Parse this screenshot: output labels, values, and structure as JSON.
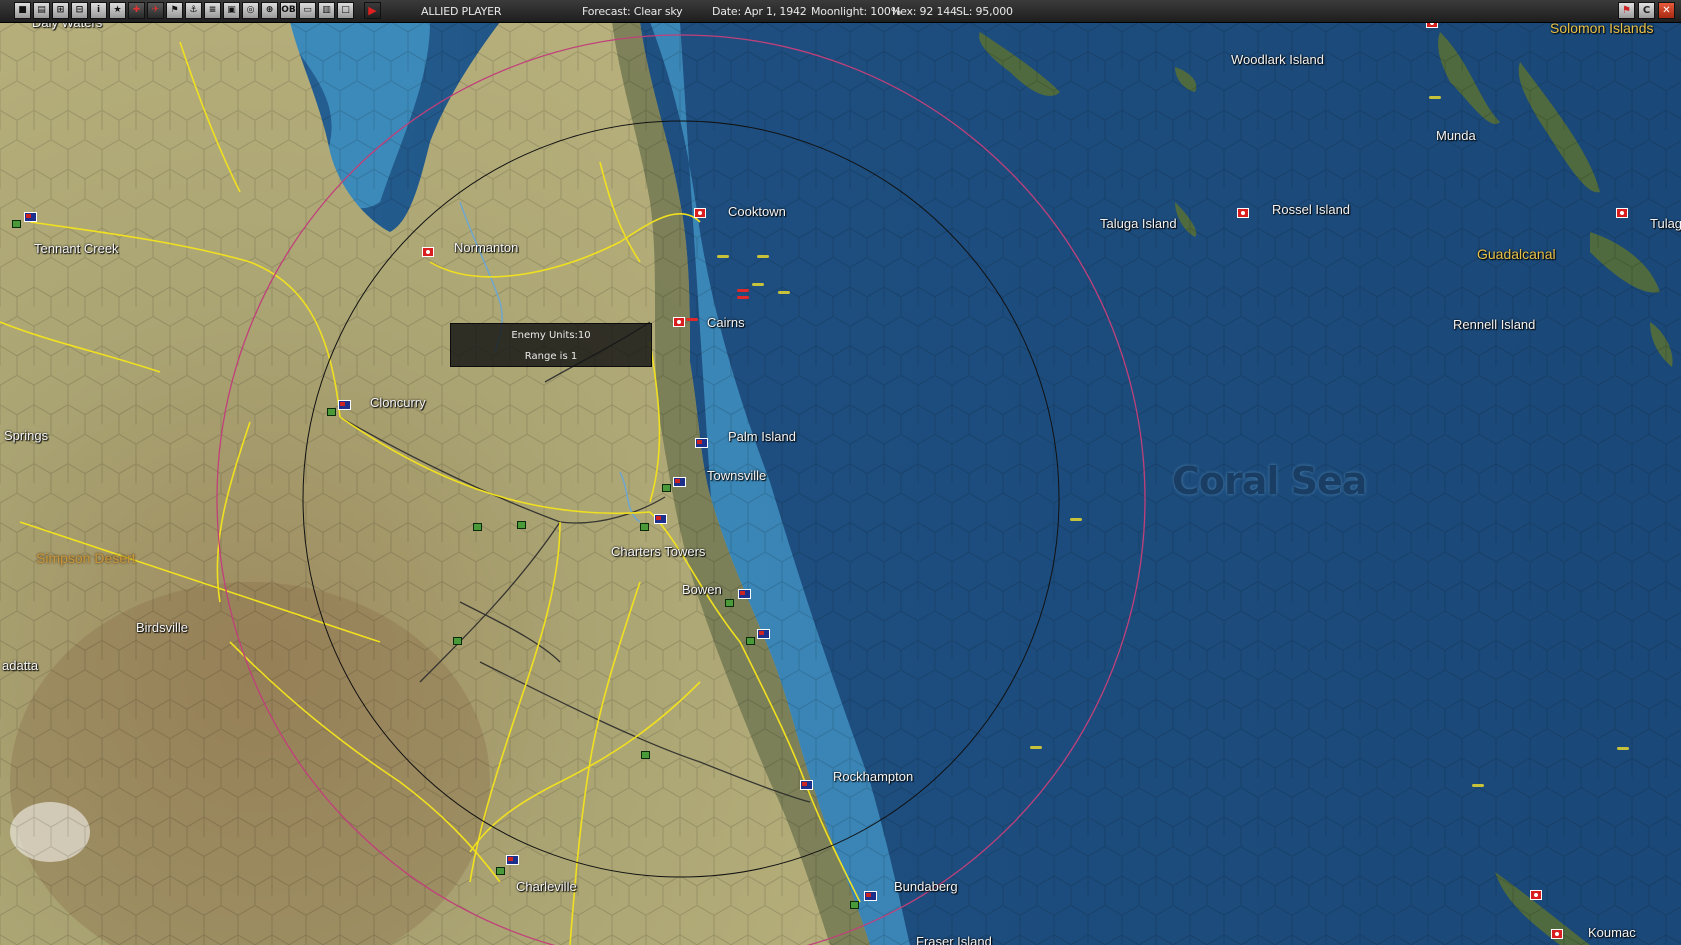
{
  "toolbar": {
    "buttons": [
      "■",
      "▤",
      "⊞",
      "⊟",
      "i",
      "★",
      "✚",
      "✈",
      "⚑",
      "⚓",
      "≡",
      "▣",
      "◎",
      "⊕",
      "OB",
      "▭",
      "▥",
      "□"
    ],
    "play_icon": "play-icon"
  },
  "status": {
    "player": "ALLIED PLAYER",
    "forecast": "Forecast: Clear sky",
    "date": "Date: Apr 1, 1942",
    "moonlight": "Moonlight: 100%",
    "hex": "Hex: 92 144",
    "sl": "SL: 95,000"
  },
  "window_controls": {
    "flag": "⚑",
    "c": "C",
    "close": "✕"
  },
  "tooltip": {
    "line1": "Enemy Units:10",
    "line2": "Range is 1"
  },
  "labels": {
    "daly_waters": "Daly Waters",
    "tennant_creek": "Tennant Creek",
    "springs": "Springs",
    "simpson_desert": "Simpson Desert",
    "birdsville": "Birdsville",
    "adatta": "adatta",
    "normanton": "Normanton",
    "cloncurry": "Cloncurry",
    "cooktown": "Cooktown",
    "cairns": "Cairns",
    "palm_island": "Palm Island",
    "townsville": "Townsville",
    "charters_towers": "Charters Towers",
    "bowen": "Bowen",
    "rockhampton": "Rockhampton",
    "charleville": "Charleville",
    "bundaberg": "Bundaberg",
    "fraser_island": "Fraser Island",
    "woodlark_island": "Woodlark Island",
    "solomon_islands": "Solomon Islands",
    "munda": "Munda",
    "taluga_island": "Taluga Island",
    "rossel_island": "Rossel Island",
    "guadalcanal": "Guadalcanal",
    "tulag": "Tulag",
    "rennell_island": "Rennell Island",
    "coral_sea": "Coral Sea",
    "koumac": "Koumac"
  },
  "colors": {
    "land": "#a8a070",
    "shallow_water": "#3f8fbf",
    "deep_water": "#1d4a78",
    "road": "#f0e020",
    "rail": "#2a2a2a",
    "range_outer": "#c0407a",
    "range_inner": "#111111",
    "allied": "#1c2f8a",
    "japanese": "#d81e1e"
  }
}
